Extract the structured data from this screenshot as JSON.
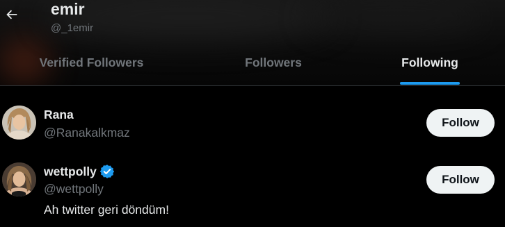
{
  "header": {
    "title": "emir",
    "handle": "@_1emir",
    "back_icon": "arrow-left-icon"
  },
  "tabs": [
    {
      "label": "Verified Followers",
      "active": false
    },
    {
      "label": "Followers",
      "active": false
    },
    {
      "label": "Following",
      "active": true
    }
  ],
  "users": [
    {
      "name": "Rana",
      "handle": "@Ranakalkmaz",
      "verified": false,
      "bio": "",
      "follow_label": "Follow"
    },
    {
      "name": "wettpolly",
      "handle": "@wettpolly",
      "verified": true,
      "bio": "Ah twitter geri döndüm!",
      "follow_label": "Follow"
    }
  ],
  "colors": {
    "accent": "#1d9bf0",
    "background": "#000000",
    "text": "#e7e9ea",
    "muted": "#71767b",
    "button_bg": "#eff3f4"
  }
}
